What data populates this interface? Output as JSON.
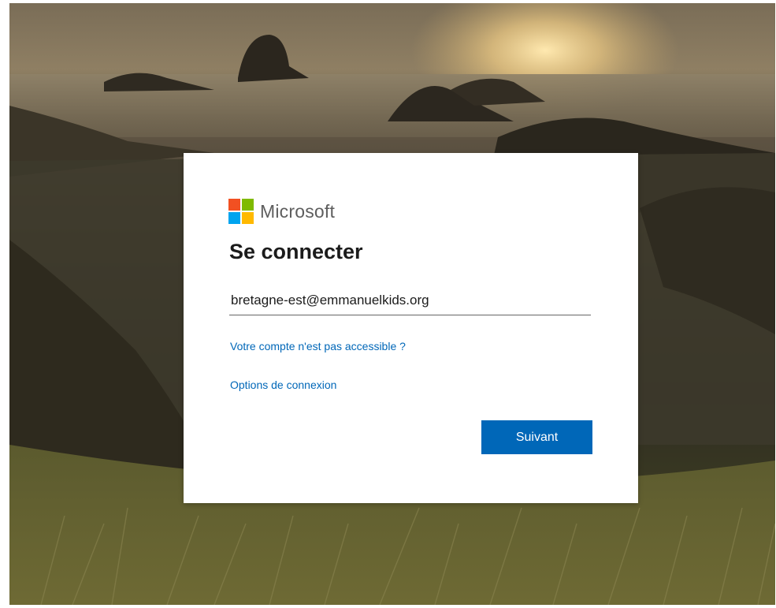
{
  "brand": {
    "name": "Microsoft",
    "logo_colors": [
      "#f25022",
      "#7fba00",
      "#00a4ef",
      "#ffb900"
    ]
  },
  "signin": {
    "title": "Se connecter",
    "email_value": "bretagne-est@emmanuelkids.org",
    "cant_access_link": "Votre compte n'est pas accessible ?",
    "signin_options_link": "Options de connexion",
    "next_button": "Suivant"
  },
  "theme": {
    "accent": "#0067b8"
  }
}
